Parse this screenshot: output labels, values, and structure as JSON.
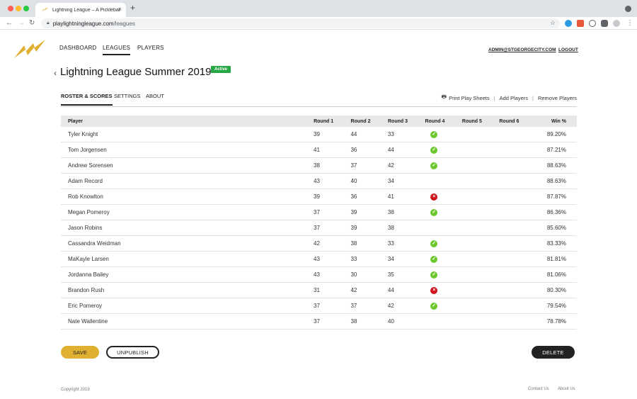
{
  "browser": {
    "tab_title": "Lightning League – A Pickleball",
    "new_tab_symbol": "+",
    "close_symbol": "×",
    "url_host": "playlightningleague.com",
    "url_path": "/leagues"
  },
  "header": {
    "nav": [
      {
        "label": "DASHBOARD"
      },
      {
        "label": "LEAGUES"
      },
      {
        "label": "PLAYERS"
      }
    ],
    "account_email": "ADMIN@STGEORGECITY.COM",
    "logout_label": "LOGOUT"
  },
  "league": {
    "title": "Lightning League Summer 2019",
    "status": "Active"
  },
  "subtabs": [
    {
      "label": "ROSTER & SCORES"
    },
    {
      "label": "SETTINGS"
    },
    {
      "label": "ABOUT"
    }
  ],
  "actions": {
    "print": "Print Play Sheets",
    "add": "Add Players",
    "remove": "Remove Players",
    "separator": "|"
  },
  "table": {
    "columns": [
      "Player",
      "Round 1",
      "Round 2",
      "Round 3",
      "Round 4",
      "Round 5",
      "Round 6",
      "Win %"
    ],
    "rows": [
      {
        "player": "Tyler Knight",
        "r1": "39",
        "r2": "44",
        "r3": "33",
        "r4": "check",
        "win": "89.20%"
      },
      {
        "player": "Tom Jorgensen",
        "r1": "41",
        "r2": "36",
        "r3": "44",
        "r4": "check",
        "win": "87.21%"
      },
      {
        "player": "Andrew Sorensen",
        "r1": "38",
        "r2": "37",
        "r3": "42",
        "r4": "check",
        "win": "88.63%"
      },
      {
        "player": "Adam Record",
        "r1": "43",
        "r2": "40",
        "r3": "34",
        "r4": "",
        "win": "88.63%"
      },
      {
        "player": "Rob Knowlton",
        "r1": "39",
        "r2": "36",
        "r3": "41",
        "r4": "x",
        "win": "87.87%"
      },
      {
        "player": "Megan Pomeroy",
        "r1": "37",
        "r2": "39",
        "r3": "38",
        "r4": "check",
        "win": "86.36%"
      },
      {
        "player": "Jason Robins",
        "r1": "37",
        "r2": "39",
        "r3": "38",
        "r4": "",
        "win": "85.60%"
      },
      {
        "player": "Cassandra Weidman",
        "r1": "42",
        "r2": "38",
        "r3": "33",
        "r4": "check",
        "win": "83.33%"
      },
      {
        "player": "MaKayle Larsen",
        "r1": "43",
        "r2": "33",
        "r3": "34",
        "r4": "check",
        "win": "81.81%"
      },
      {
        "player": "Jordanna Bailey",
        "r1": "43",
        "r2": "30",
        "r3": "35",
        "r4": "check",
        "win": "81.06%"
      },
      {
        "player": "Brandon Rush",
        "r1": "31",
        "r2": "42",
        "r3": "44",
        "r4": "x",
        "win": "80.30%"
      },
      {
        "player": "Eric Pomeroy",
        "r1": "37",
        "r2": "37",
        "r3": "42",
        "r4": "check",
        "win": "79.54%"
      },
      {
        "player": "Nate Wallentine",
        "r1": "37",
        "r2": "38",
        "r3": "40",
        "r4": "",
        "win": "78.78%"
      }
    ]
  },
  "buttons": {
    "save": "SAVE",
    "unpublish": "UNPUBLISH",
    "delete": "DELETE"
  },
  "footer": {
    "copyright": "Copyright 2019",
    "contact": "Contact Us",
    "about": "About Us"
  },
  "colors": {
    "accent": "#e0b030",
    "active_badge": "#27a844",
    "check": "#6cc72e",
    "x_mark": "#d0121b"
  }
}
